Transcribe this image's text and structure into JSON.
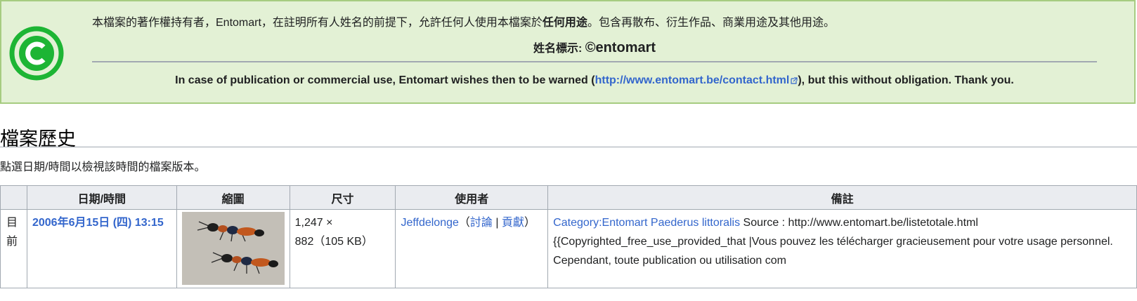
{
  "license": {
    "text_before": "本檔案的著作權持有者，Entomart，在註明所有人姓名的前提下，允許任何人使用本檔案於",
    "text_bold": "任何用途",
    "text_after": "。包含再散布、衍生作品、商業用途及其他用途。",
    "attribution_label": "姓名標示: ",
    "attribution_value": "©entomart",
    "notice_before": "In case of publication or commercial use, Entomart wishes then to be warned (",
    "notice_link": "http://www.entomart.be/contact.html",
    "notice_after": "), but this without obligation. Thank you.",
    "icon": "copyright-icon",
    "accent_color": "#1db534"
  },
  "history": {
    "heading": "檔案歷史",
    "hint": "點選日期/時間以檢視該時間的檔案版本。",
    "columns": [
      "",
      "日期/時間",
      "縮圖",
      "尺寸",
      "使用者",
      "備註"
    ],
    "rows": [
      {
        "status": "目前",
        "datetime": "2006年6月15日 (四) 13:15",
        "thumbnail_icon": "beetle-thumbnail",
        "size_line1": "1,247 ×",
        "size_line2": "882（105 KB）",
        "user": "Jeffdelonge",
        "user_open": "（",
        "user_talk": "討論",
        "user_sep": " | ",
        "user_contribs": "貢獻",
        "user_close": "）",
        "comment_link": "Category:Entomart Paederus littoralis",
        "comment_text": " Source : http://www.entomart.be/listetotale.html {{Copyrighted_free_use_provided_that |Vous pouvez les télécharger gracieusement pour votre usage personnel. Cependant, toute publication ou utilisation com"
      }
    ]
  }
}
